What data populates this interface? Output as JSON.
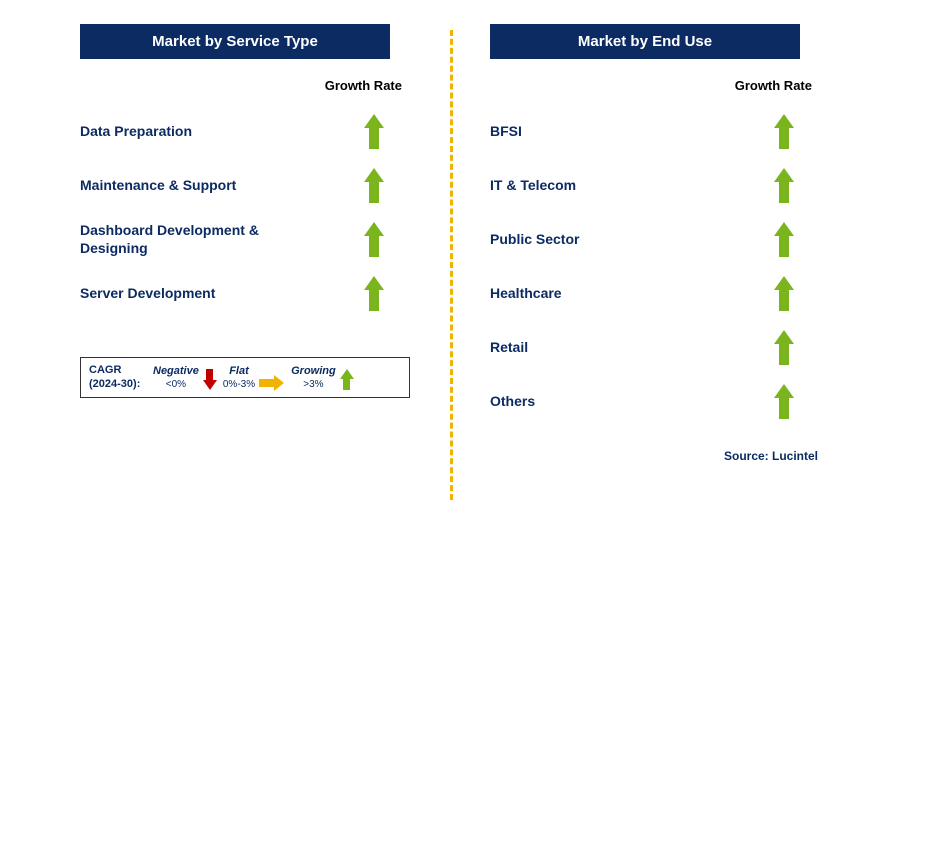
{
  "left_panel": {
    "title": "Market by Service Type",
    "growth_header": "Growth Rate",
    "items": [
      {
        "label": "Data Preparation",
        "growth": "growing"
      },
      {
        "label": "Maintenance & Support",
        "growth": "growing"
      },
      {
        "label": "Dashboard Development & Designing",
        "growth": "growing"
      },
      {
        "label": "Server Development",
        "growth": "growing"
      }
    ]
  },
  "right_panel": {
    "title": "Market by End Use",
    "growth_header": "Growth Rate",
    "items": [
      {
        "label": "BFSI",
        "growth": "growing"
      },
      {
        "label": "IT & Telecom",
        "growth": "growing"
      },
      {
        "label": "Public Sector",
        "growth": "growing"
      },
      {
        "label": "Healthcare",
        "growth": "growing"
      },
      {
        "label": "Retail",
        "growth": "growing"
      },
      {
        "label": "Others",
        "growth": "growing"
      }
    ]
  },
  "legend": {
    "title_line1": "CAGR",
    "title_line2": "(2024-30):",
    "negative_label": "Negative",
    "negative_range": "<0%",
    "flat_label": "Flat",
    "flat_range": "0%-3%",
    "growing_label": "Growing",
    "growing_range": ">3%"
  },
  "source": "Source: Lucintel",
  "colors": {
    "header_bg": "#0c2b62",
    "text_navy": "#0c2b62",
    "arrow_up": "#7ab51d",
    "arrow_down": "#c00000",
    "arrow_flat": "#f0b400",
    "divider": "#f0b400"
  },
  "chart_data": {
    "type": "table",
    "title": "Growth Rate by Market Segment (CAGR 2024-30)",
    "legend_scale": {
      "Negative": "<0%",
      "Flat": "0%-3%",
      "Growing": ">3%"
    },
    "series": [
      {
        "name": "Market by Service Type",
        "categories": [
          "Data Preparation",
          "Maintenance & Support",
          "Dashboard Development & Designing",
          "Server Development"
        ],
        "values": [
          "Growing",
          "Growing",
          "Growing",
          "Growing"
        ]
      },
      {
        "name": "Market by End Use",
        "categories": [
          "BFSI",
          "IT & Telecom",
          "Public Sector",
          "Healthcare",
          "Retail",
          "Others"
        ],
        "values": [
          "Growing",
          "Growing",
          "Growing",
          "Growing",
          "Growing",
          "Growing"
        ]
      }
    ]
  }
}
